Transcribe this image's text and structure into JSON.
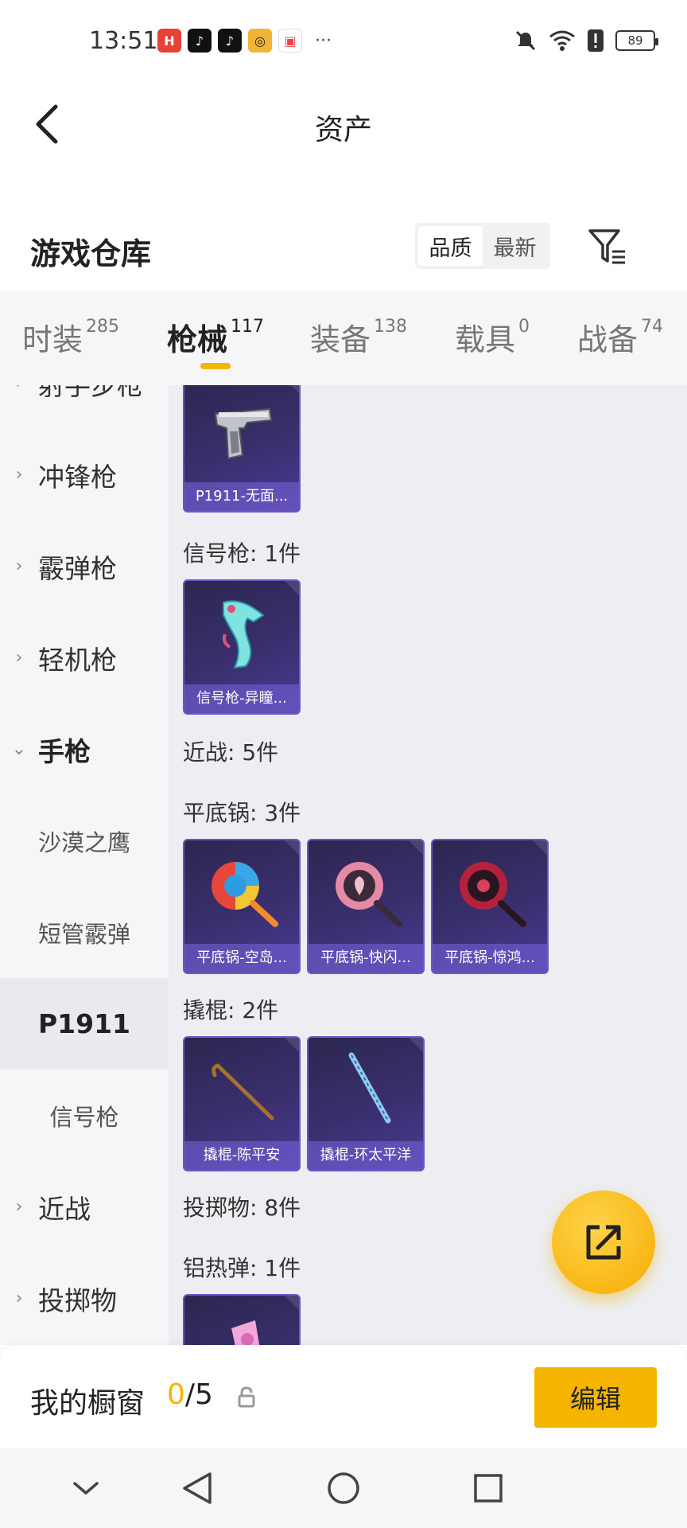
{
  "status_bar": {
    "time": "13:51",
    "app_icons": [
      "huawei-app-icon",
      "tiktok-icon",
      "tiktok-icon",
      "target-app-icon",
      "gift-box-icon"
    ],
    "more": "···",
    "battery": "89"
  },
  "header": {
    "title": "资产"
  },
  "warehouse": {
    "title": "游戏仓库",
    "sort_options": [
      "品质",
      "最新"
    ],
    "active_sort": "品质"
  },
  "tabs": [
    {
      "label": "时装",
      "count": "285"
    },
    {
      "label": "枪械",
      "count": "117"
    },
    {
      "label": "装备",
      "count": "138"
    },
    {
      "label": "载具",
      "count": "0"
    },
    {
      "label": "战备",
      "count": "74"
    }
  ],
  "active_tab": "枪械",
  "sidebar": {
    "items": [
      {
        "label": "射手步枪",
        "type": "category"
      },
      {
        "label": "冲锋枪",
        "type": "category"
      },
      {
        "label": "霰弹枪",
        "type": "category"
      },
      {
        "label": "轻机枪",
        "type": "category"
      },
      {
        "label": "手枪",
        "type": "category-expanded"
      },
      {
        "label": "沙漠之鹰",
        "type": "sub"
      },
      {
        "label": "短管霰弹",
        "type": "sub"
      },
      {
        "label": "P1911",
        "type": "sub-selected"
      },
      {
        "label": "信号枪",
        "type": "sub"
      },
      {
        "label": "近战",
        "type": "category"
      },
      {
        "label": "投掷物",
        "type": "category"
      }
    ]
  },
  "content": {
    "sections": [
      {
        "label": "信号枪: 1件"
      },
      {
        "label": "近战: 5件"
      },
      {
        "label": "平底锅: 3件"
      },
      {
        "label": "撬棍: 2件"
      },
      {
        "label": "投掷物: 8件"
      },
      {
        "label": "铝热弹: 1件"
      }
    ],
    "cards": [
      {
        "name": "P1911-无面...",
        "icon": "pistol-icon"
      },
      {
        "name": "信号枪-异瞳...",
        "icon": "flare-gun-icon"
      },
      {
        "name": "平底锅-空岛...",
        "icon": "pan-icon"
      },
      {
        "name": "平底锅-快闪...",
        "icon": "pan-icon"
      },
      {
        "name": "平底锅-惊鸿...",
        "icon": "pan-icon"
      },
      {
        "name": "撬棍-陈平安",
        "icon": "crowbar-icon"
      },
      {
        "name": "撬棍-环太平洋",
        "icon": "crowbar-icon"
      },
      {
        "name": "",
        "icon": "thermite-grenade-icon"
      }
    ]
  },
  "colors": {
    "accent": "#f5b400",
    "card_bg": "#3a2f6e",
    "card_border": "#6c56c9"
  },
  "bottom_bar": {
    "title": "我的橱窗",
    "count_current": "0",
    "count_total": "/5",
    "edit_label": "编辑"
  }
}
